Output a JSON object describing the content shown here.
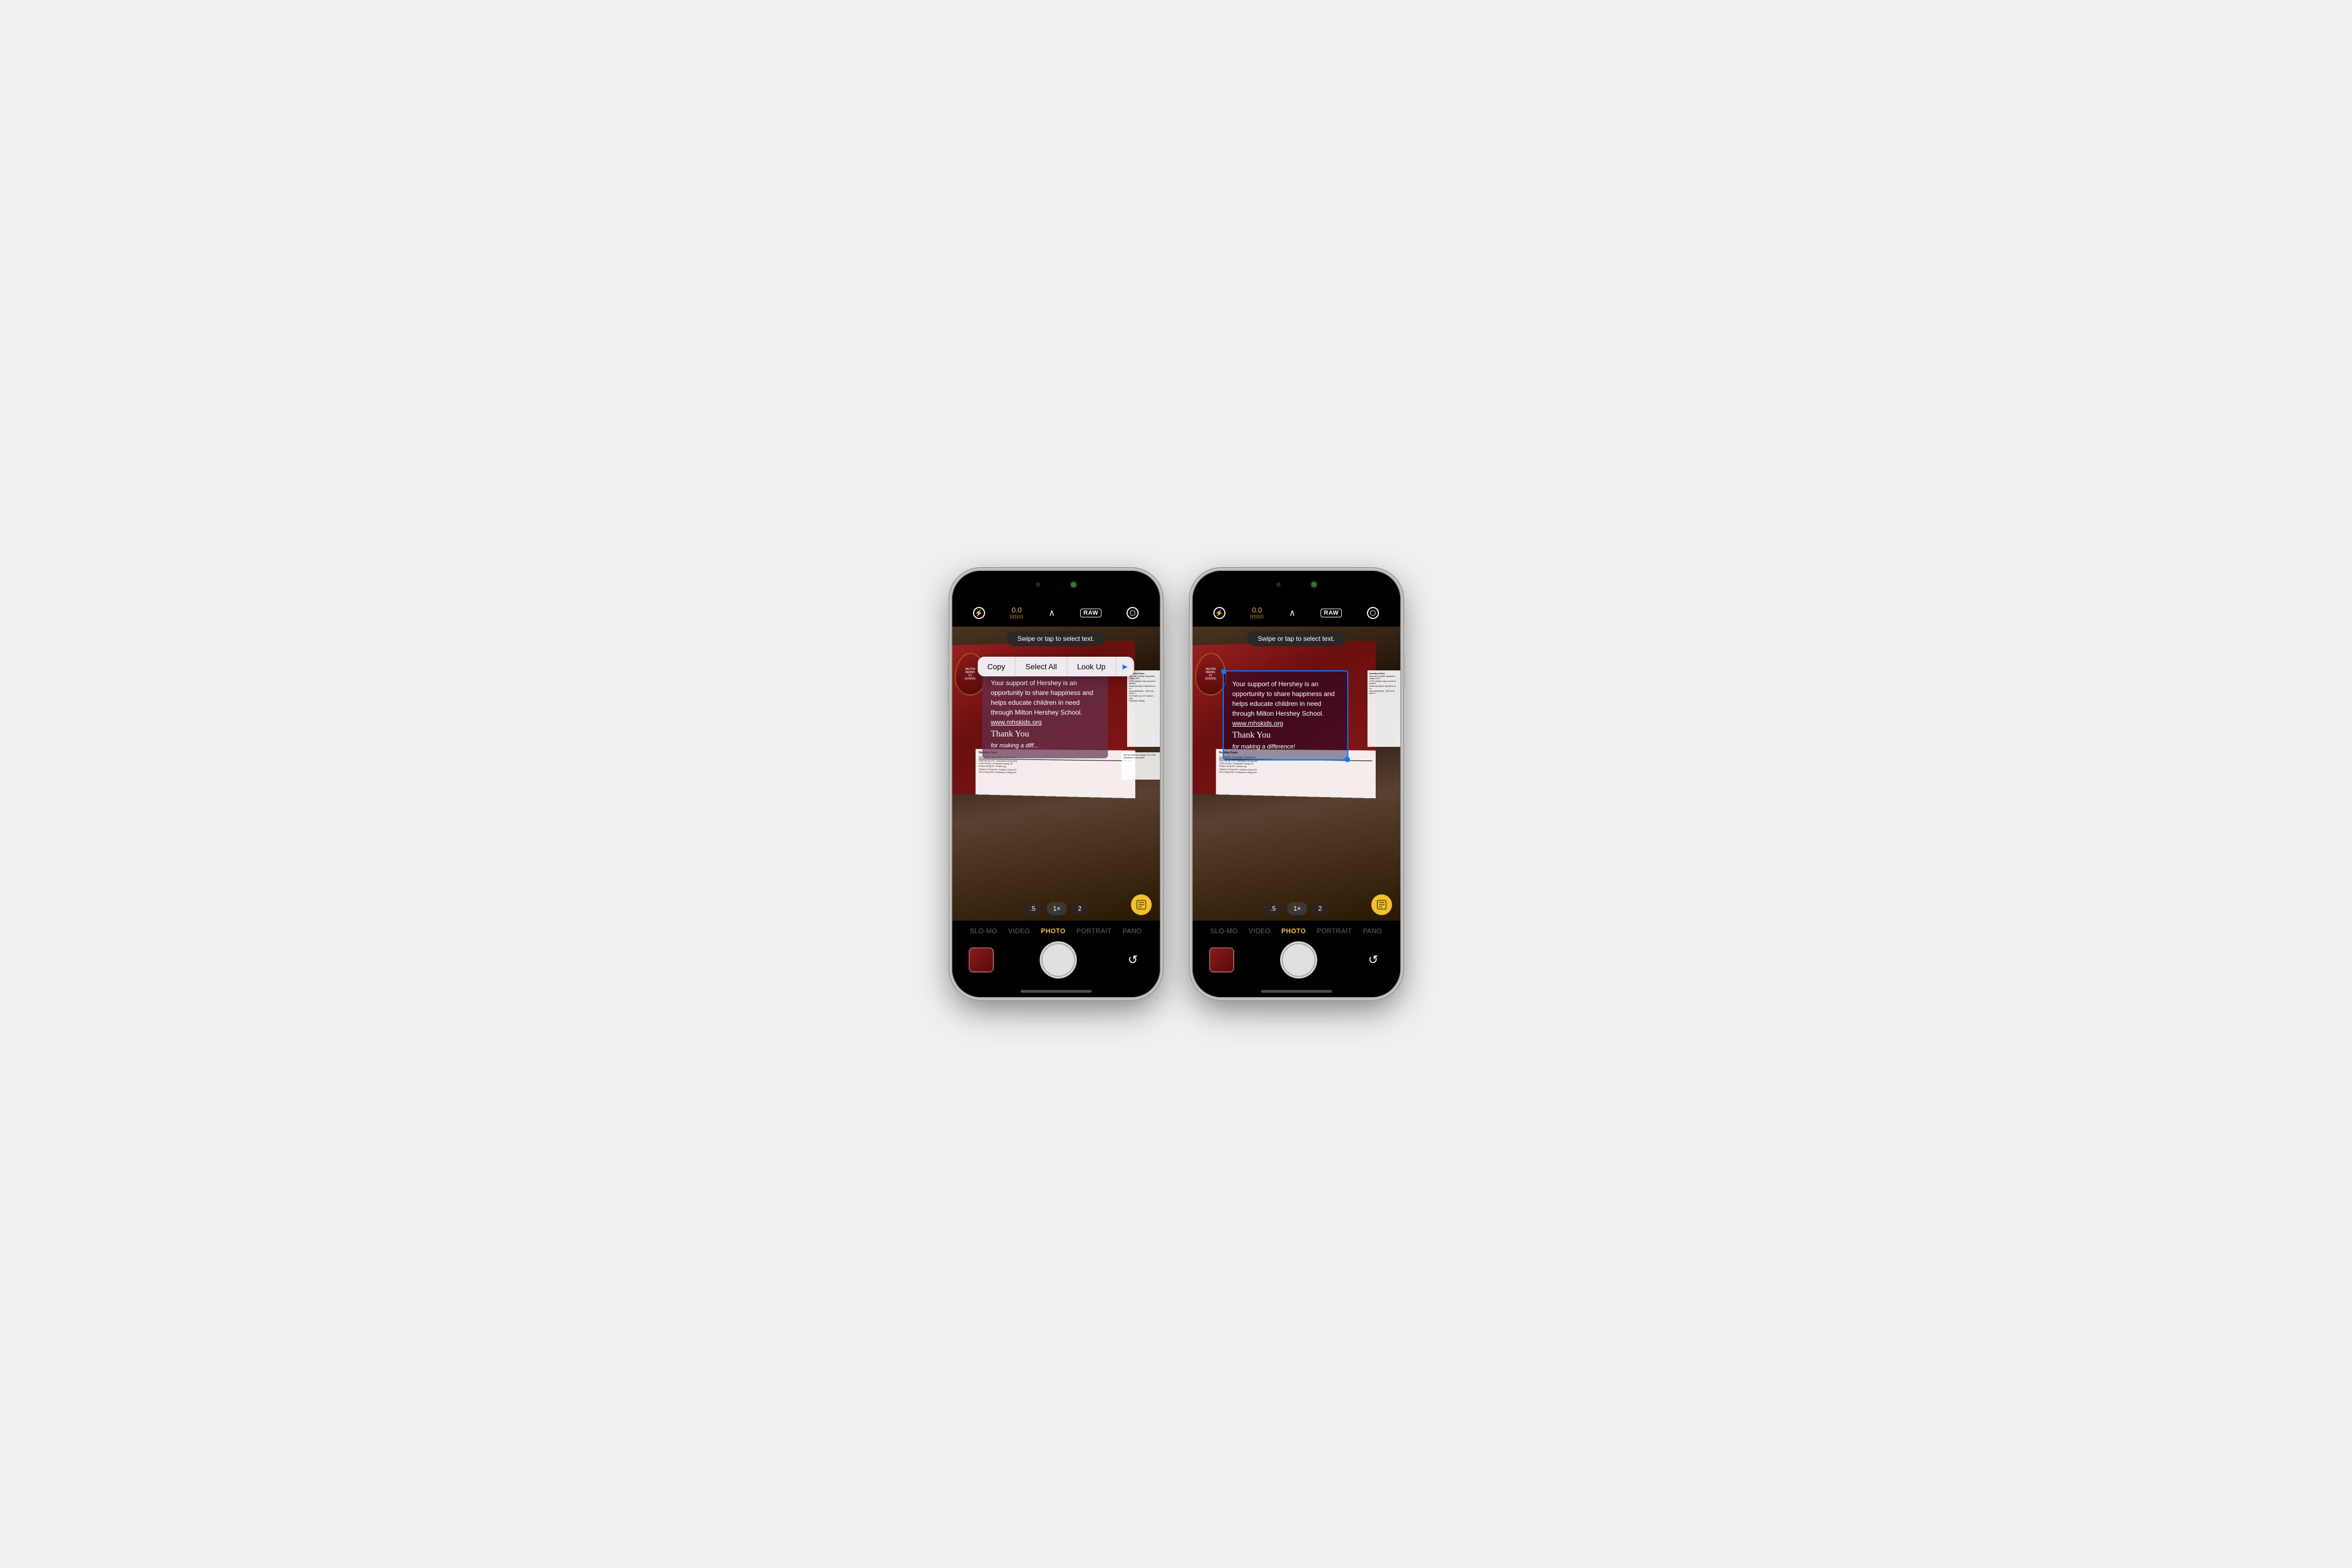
{
  "app": "iOS Camera with Live Text",
  "phones": [
    {
      "id": "phone1",
      "dynamic_island": {
        "dot_active": true
      },
      "top_bar": {
        "flash_label": "⚡",
        "exposure_value": "0.0",
        "exposure_bars": "|||||||",
        "chevron": "∧",
        "raw_label": "RAW",
        "live_label": "⊙"
      },
      "viewfinder": {
        "swipe_hint": "Swipe or tap to select text.",
        "context_menu": {
          "copy": "Copy",
          "select_all": "Select All",
          "look_up": "Look Up",
          "more": "▶"
        },
        "text_content": {
          "main": "Your support of Hershey is an opportunity to share happiness and helps educate children in need through Milton Hershey School.",
          "link": "www.mhskids.org",
          "handwriting1": "Thank You",
          "handwriting2": "for making a diff..."
        }
      },
      "zoom_controls": [
        ".5",
        "1×",
        "2"
      ],
      "active_zoom": "1×",
      "live_text_icon": "⬚",
      "modes": [
        "SLO-MO",
        "VIDEO",
        "PHOTO",
        "PORTRAIT",
        "PANO"
      ],
      "active_mode": "PHOTO"
    },
    {
      "id": "phone2",
      "dynamic_island": {
        "dot_active": true
      },
      "top_bar": {
        "flash_label": "⚡",
        "exposure_value": "0.0",
        "exposure_bars": "|||||||",
        "chevron": "∧",
        "raw_label": "RAW",
        "live_label": "⊙"
      },
      "viewfinder": {
        "swipe_hint": "Swipe or tap to select text.",
        "text_content": {
          "main": "Your support of Hershey is an opportunity to share happiness and helps educate children in need through Milton Hershey School.",
          "link": "www.mhskids.org",
          "handwriting1": "Thank You",
          "handwriting2": "for making a difference!"
        },
        "selected": true
      },
      "zoom_controls": [
        ".5",
        "1×",
        "2"
      ],
      "active_zoom": "1×",
      "live_text_icon": "⬚",
      "modes": [
        "SLO-MO",
        "VIDEO",
        "PHOTO",
        "PORTRAIT",
        "PANO"
      ],
      "active_mode": "PHOTO"
    }
  ]
}
